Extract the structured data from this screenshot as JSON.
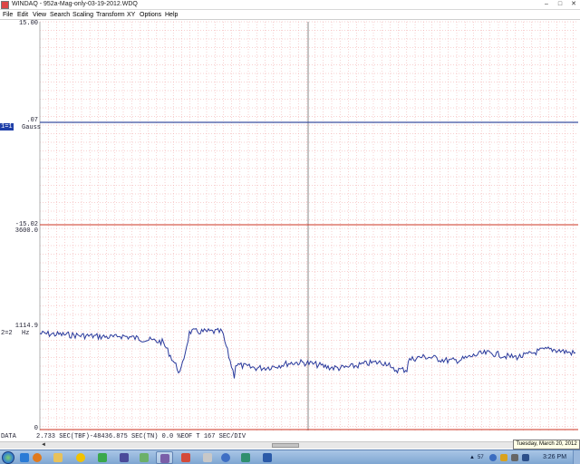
{
  "window": {
    "title": "WINDAQ - 952a-Mag-only-03-19-2012.WDQ"
  },
  "menu": {
    "items": [
      "File",
      "Edit",
      "View",
      "Search",
      "Scaling",
      "Transform",
      "XY",
      "Options",
      "Help"
    ]
  },
  "channel1": {
    "top_label": "15.00",
    "mid_label": ".07",
    "bottom_label": "-15.02",
    "badge": "1=1",
    "units": "Gauss",
    "line_color": "#3a4fa0"
  },
  "channel2": {
    "top_label": "3600.0",
    "value_label": "1114.9",
    "id_label": "2=2",
    "units": "Hz",
    "bottom_label": "0",
    "line_color": "#2a3a9c"
  },
  "grid": {
    "minor_color": "#f0a0a0",
    "baseline_color": "#cc3322",
    "cursor_color": "#888888"
  },
  "status": {
    "mode": "DATA",
    "text": "2.733 SEC(TBF)-48436.875 SEC(TN)   0.0 %EOF T  167 SEC/DIV"
  },
  "tooltip": "Tuesday, March 20, 2012",
  "taskbar": {
    "tray_number": "57",
    "clock": "3:26 PM",
    "apps": [
      "internet-explorer-icon",
      "firefox-icon",
      "folder-icon",
      "messenger-icon",
      "games-icon",
      "media-icon",
      "windaq-icon",
      "windows-explorer-icon",
      "paint-icon",
      "help-icon",
      "chart-icon",
      "word-icon"
    ]
  }
}
